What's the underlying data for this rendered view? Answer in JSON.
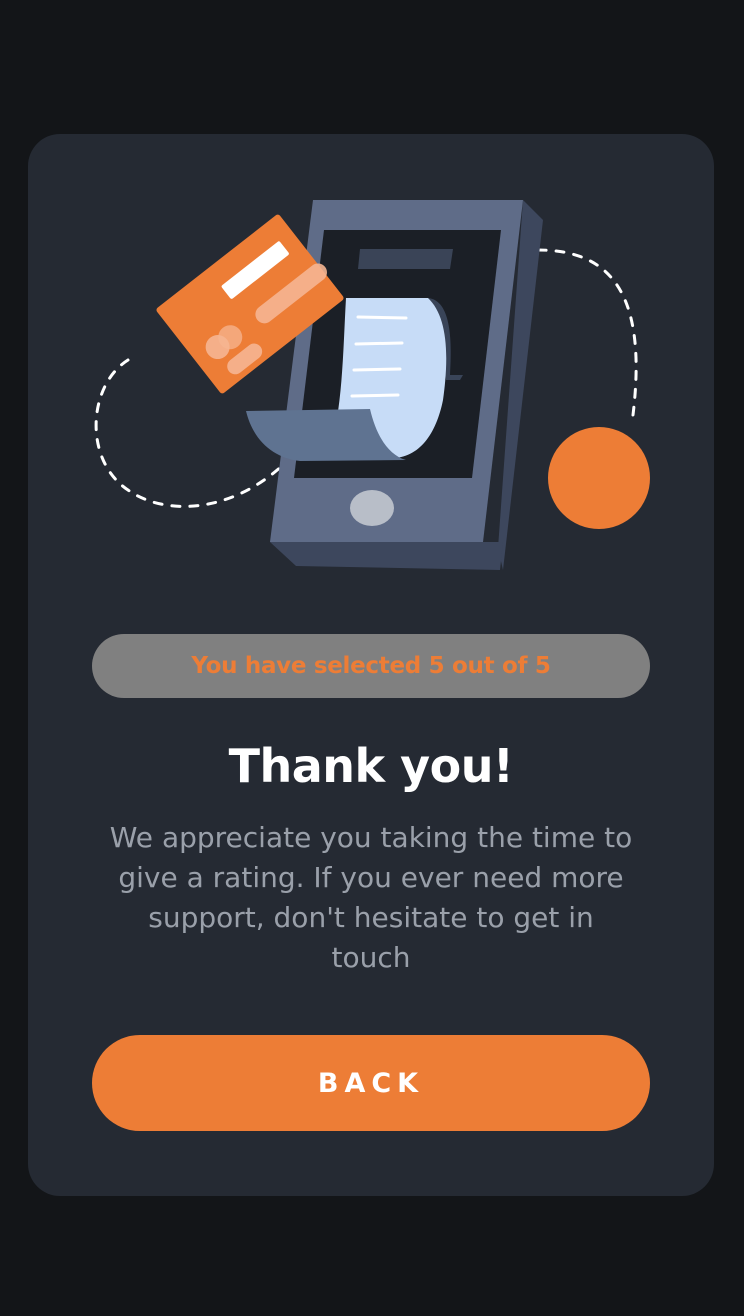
{
  "rating": {
    "selection_text": "You have selected 5 out of 5",
    "selected": 5,
    "max": 5
  },
  "thanks": {
    "title": "Thank you!",
    "message": "We appreciate you taking the time to give a rating. If you ever need more support, don't hesitate to get in touch"
  },
  "actions": {
    "back_label": "BACK"
  },
  "colors": {
    "accent": "#ed7d36",
    "card_bg": "#252a33",
    "page_bg": "#131518",
    "pill_bg": "#808080"
  },
  "illustration": {
    "icon": "phone-with-receipt-and-credit-card"
  }
}
